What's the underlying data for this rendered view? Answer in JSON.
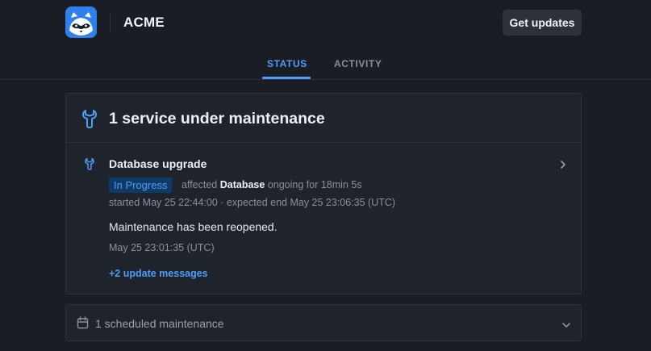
{
  "header": {
    "brand": "ACME",
    "get_updates_label": "Get updates",
    "logo_icon": "raccoon-logo-icon"
  },
  "tabs": [
    {
      "label": "STATUS",
      "active": true
    },
    {
      "label": "ACTIVITY",
      "active": false
    }
  ],
  "maintenance_card": {
    "title": "1 service under maintenance",
    "icon": "wrench-icon",
    "incident": {
      "title": "Database upgrade",
      "status_badge": "In Progress",
      "affected_prefix": "affected",
      "affected_service": "Database",
      "ongoing": "ongoing for 18min 5s",
      "timing": "started May 25 22:44:00 · expected end May 25 23:06:35 (UTC)",
      "message": "Maintenance has been reopened.",
      "message_time": "May 25 23:01:35 (UTC)",
      "more_updates_link": "+2 update messages"
    }
  },
  "scheduled": {
    "label": "1 scheduled maintenance",
    "icon": "calendar-icon"
  },
  "colors": {
    "background": "#1a1d24",
    "card": "#1f232b",
    "accent": "#4f9cf9",
    "logo": "#2f80ed",
    "badge_bg": "#103a66"
  }
}
